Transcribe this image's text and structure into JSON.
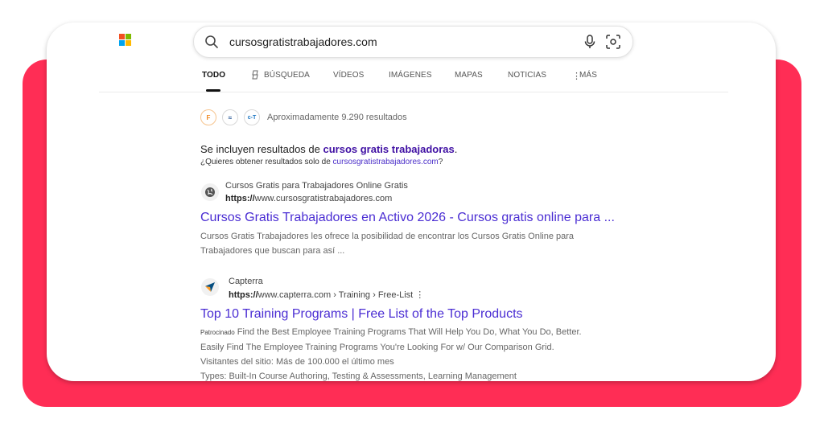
{
  "search": {
    "query": "cursosgratistrabajadores.com"
  },
  "tabs": [
    {
      "label": "TODO"
    },
    {
      "label": "BÚSQUEDA"
    },
    {
      "label": "VÍDEOS"
    },
    {
      "label": "IMÁGENES"
    },
    {
      "label": "MAPAS"
    },
    {
      "label": "NOTICIAS"
    },
    {
      "label": "MÁS"
    }
  ],
  "results_info": {
    "count_text": "Aproximadamente 9.290 resultados",
    "badges": [
      "F",
      "≈",
      "c-T"
    ]
  },
  "spelling": {
    "prefix": "Se incluyen resultados de ",
    "suggestion": "cursos gratis trabajadoras",
    "suffix": ".",
    "only_prefix": "¿Quieres obtener resultados solo de ",
    "only_link": "cursosgratistrabajadores.com",
    "only_suffix": "?"
  },
  "results": [
    {
      "site_name": "Cursos Gratis para Trabajadores Online Gratis",
      "url_scheme": "https://",
      "url_rest": "www.cursosgratistrabajadores.com",
      "title": "Cursos Gratis Trabajadores en Activo 2026 - Cursos gratis online para ...",
      "snippet_lines": [
        "Cursos Gratis Trabajadores les ofrece la posibilidad de encontrar los Cursos Gratis Online para",
        "Trabajadores que buscan para así ..."
      ]
    },
    {
      "site_name": "Capterra",
      "url_scheme": "https://",
      "url_rest": "www.capterra.com › Training › Free-List",
      "title": "Top 10 Training Programs | Free List of the Top Products",
      "ad_label": "Patrocinado",
      "snippet_lines": [
        " Find the Best Employee Training Programs That Will Help You Do, What You Do, Better.",
        "Easily Find The Employee Training Programs You're Looking For w/ Our Comparison Grid.",
        "Visitantes del sitio: Más de 100.000 el último mes",
        "Types: Built-In Course Authoring, Testing & Assessments, Learning Management"
      ]
    }
  ],
  "colors": {
    "accent_red": "#ff2d55",
    "link_purple": "#4a2dd3",
    "ms_red": "#f25022",
    "ms_green": "#7fba00",
    "ms_blue": "#00a4ef",
    "ms_yellow": "#ffb900"
  },
  "icons": [
    "microsoft-logo-icon",
    "search-icon",
    "microphone-icon",
    "visual-search-icon",
    "copilot-icon",
    "more-dots-icon",
    "globe-icon",
    "capterra-icon",
    "kebab-icon"
  ]
}
